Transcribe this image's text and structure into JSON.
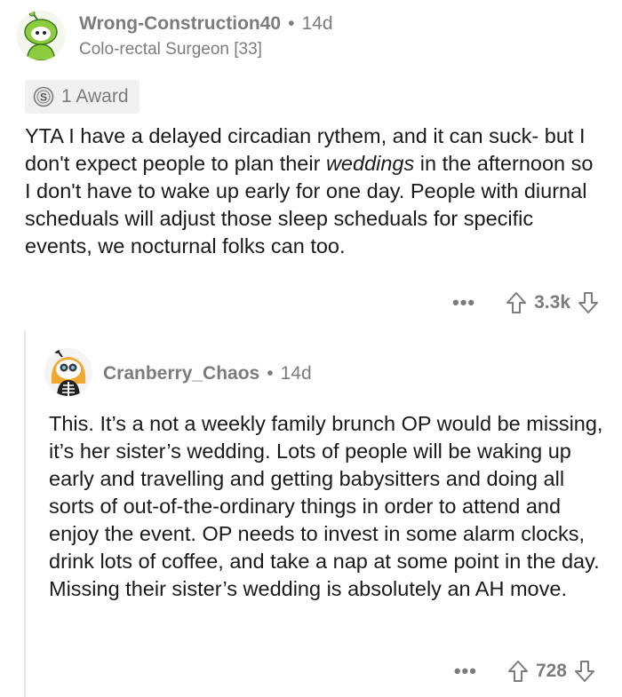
{
  "comment1": {
    "username": "Wrong-Construction40",
    "separator": "•",
    "age": "14d",
    "flair": "Colo-rectal Surgeon [33]",
    "award_label": "1 Award",
    "body_part1": "YTA I have a delayed circadian rythem, and it can suck- but I don't expect people to plan their ",
    "body_italic": "weddings",
    "body_part2": " in the afternoon so I don't have to wake up early for one day. People with diurnal scheduals will adjust those sleep scheduals for specific events, we nocturnal folks can too.",
    "more": "•••",
    "score": "3.3k"
  },
  "comment2": {
    "username": "Cranberry_Chaos",
    "separator": "•",
    "age": "14d",
    "body": "This. It’s a not a weekly family brunch OP would be missing, it’s her sister’s wedding. Lots of people will be waking up early and travelling and getting babysitters and doing all sorts of out-of-the-ordinary things in order to attend and enjoy the event. OP needs to invest in some alarm clocks, drink lots of coffee, and take a nap at some point in the day. Missing their sister’s wedding is absolutely an AH move.",
    "more": "•••",
    "score": "728"
  },
  "colors": {
    "text": "#1a1a1b",
    "meta": "#7c7c7c",
    "award_bg": "#f0f0f0",
    "thread_line": "#e5e5e5"
  }
}
